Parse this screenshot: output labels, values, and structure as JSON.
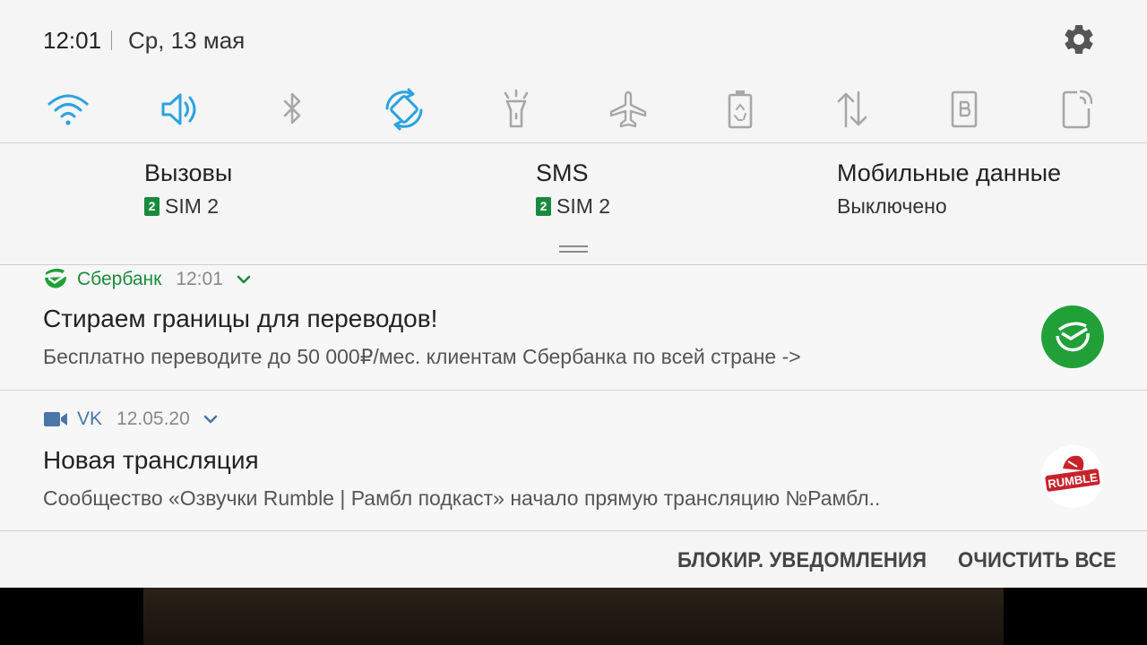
{
  "status": {
    "time": "12:01",
    "date": "Ср, 13 мая"
  },
  "quick_settings": [
    {
      "icon": "wifi-icon",
      "active": true
    },
    {
      "icon": "sound-icon",
      "active": true
    },
    {
      "icon": "bluetooth-icon",
      "active": false
    },
    {
      "icon": "auto-rotate-icon",
      "active": true
    },
    {
      "icon": "flashlight-icon",
      "active": false
    },
    {
      "icon": "airplane-mode-icon",
      "active": false
    },
    {
      "icon": "power-saving-icon",
      "active": false
    },
    {
      "icon": "mobile-data-icon",
      "active": false
    },
    {
      "icon": "blue-light-filter-icon",
      "active": false
    },
    {
      "icon": "nfc-icon",
      "active": false
    }
  ],
  "sim": {
    "calls": {
      "title": "Вызовы",
      "badge": "2",
      "value": "SIM 2"
    },
    "sms": {
      "title": "SMS",
      "badge": "2",
      "value": "SIM 2"
    },
    "data": {
      "title": "Мобильные данные",
      "value": "Выключено"
    }
  },
  "notifications": [
    {
      "app": "Сбербанк",
      "time": "12:01",
      "title": "Стираем границы для переводов!",
      "text": "Бесплатно переводите до 50 000₽/мес. клиентам Сбербанка по всей стране ->",
      "app_color": "#1b8a3a"
    },
    {
      "app": "VK",
      "time": "12.05.20",
      "title": "Новая трансляция",
      "text": "Сообщество «Озвучки Rumble | Рамбл подкаст» начало прямую трансляцию №Рамбл..",
      "app_color": "#4a76a8",
      "thumb_text": "RUMBLE"
    }
  ],
  "actions": {
    "block": "БЛОКИР. УВЕДОМЛЕНИЯ",
    "clear": "ОЧИСТИТЬ ВСЕ"
  },
  "colors": {
    "accent": "#2ba2e0",
    "inactive_icon": "#a7a7a7",
    "sber_green": "#21a038"
  }
}
